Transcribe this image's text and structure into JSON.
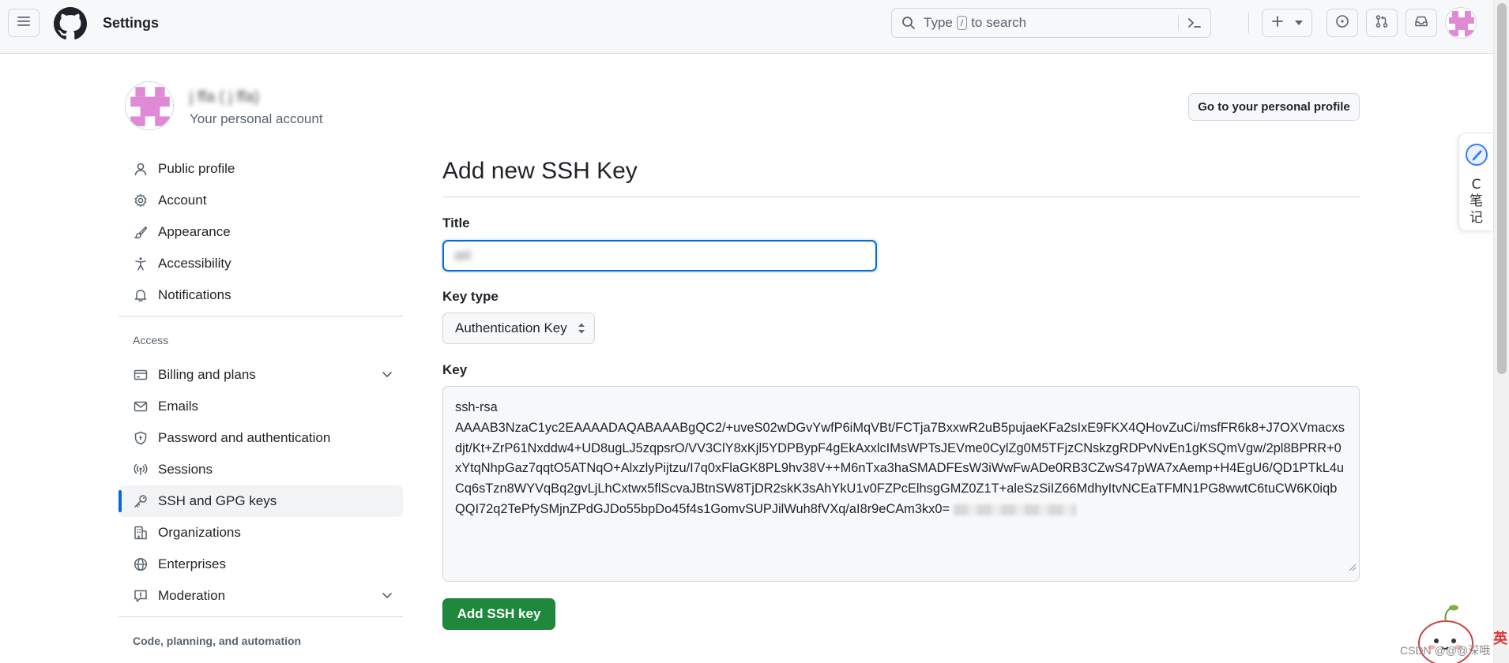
{
  "header": {
    "title": "Settings",
    "search": {
      "placeholder_before": "Type",
      "key": "/",
      "placeholder_after": "to search"
    },
    "plus_label": "+"
  },
  "profile": {
    "name": "j   ffa ( j   ffa)",
    "subtitle": "Your personal account",
    "go_profile_label": "Go to your personal profile"
  },
  "sidebar": {
    "items_top": [
      {
        "label": "Public profile",
        "icon": "person-icon"
      },
      {
        "label": "Account",
        "icon": "gear-icon"
      },
      {
        "label": "Appearance",
        "icon": "paintbrush-icon"
      },
      {
        "label": "Accessibility",
        "icon": "accessibility-icon"
      },
      {
        "label": "Notifications",
        "icon": "bell-icon"
      }
    ],
    "access_heading": "Access",
    "items_access": [
      {
        "label": "Billing and plans",
        "icon": "credit-card-icon",
        "expandable": true
      },
      {
        "label": "Emails",
        "icon": "mail-icon"
      },
      {
        "label": "Password and authentication",
        "icon": "shield-lock-icon"
      },
      {
        "label": "Sessions",
        "icon": "broadcast-icon"
      },
      {
        "label": "SSH and GPG keys",
        "icon": "key-icon",
        "active": true
      },
      {
        "label": "Organizations",
        "icon": "organization-icon"
      },
      {
        "label": "Enterprises",
        "icon": "globe-icon"
      },
      {
        "label": "Moderation",
        "icon": "report-icon",
        "expandable": true
      }
    ],
    "code_heading": "Code, planning, and automation"
  },
  "main": {
    "title": "Add new SSH Key",
    "title_label": "Title",
    "title_value": "          ert",
    "key_type_label": "Key type",
    "key_type_value": "Authentication Key",
    "key_label": "Key",
    "key_value_head": "ssh-rsa",
    "key_value": "AAAAB3NzaC1yc2EAAAADAQABAAABgQC2/+uveS02wDGvYwfP6iMqVBt/FCTja7BxxwR2uB5pujaeKFa2sIxE9FKX4QHovZuCi/msfFR6k8+J7OXVmacxsdjt/Kt+ZrP61Nxddw4+UD8ugLJ5zqpsrO/VV3ClY8xKjl5YDPBypF4gEkAxxlcIMsWPTsJEVme0CylZg0M5TFjzCNskzgRDPvNvEn1gKSQmVgw/2pl8BPRR+0xYtqNhpGaz7qqtO5ATNqO+AlxzlyPijtzu/I7q0xFlaGK8PL9hv38V++M6nTxa3haSMADFEsW3iWwFwADe0RB3CZwS47pWA7xAemp+H4EgU6/QD1PTkL4uCq6sTzn8WYVqBq2gvLjLhCxtwx5flScvaJBtnSW8TjDR2skK3sAhYkU1v0FZPcElhsgGMZ0Z1T+aleSzSiIZ66MdhyItvNCEaTFMN1PG8wwtC6tuCW6K0iqbQQI72q2TePfySMjnZPdGJDo55bpDo45f4s1GomvSUPJilWuh8fVXq/aI8r9eCAm3kx0=",
    "submit_label": "Add SSH key"
  },
  "widget": {
    "text": "C笔记"
  },
  "watermark": {
    "text": "CSDN @@@深哦",
    "corner_char": "英"
  },
  "colors": {
    "primary": "#1f883d",
    "focus": "#0969da",
    "active_marker": "#0969da"
  }
}
